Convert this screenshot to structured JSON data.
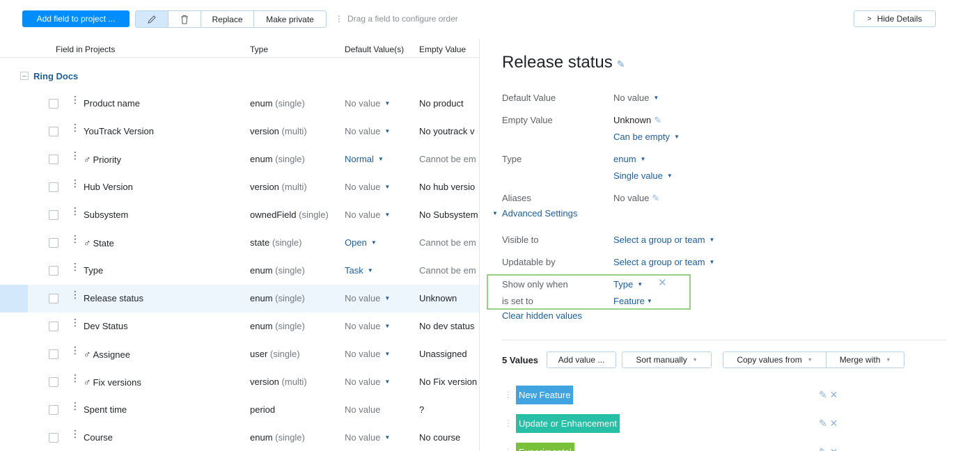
{
  "toolbar": {
    "add_label": "Add field to project ...",
    "replace_label": "Replace",
    "make_private_label": "Make private",
    "hint": "Drag a field to configure order",
    "hide_details_label": "Hide Details"
  },
  "table": {
    "headers": {
      "field": "Field in Projects",
      "type": "Type",
      "default": "Default Value(s)",
      "empty": "Empty Value"
    },
    "group": "Ring Docs",
    "rows": [
      {
        "name": "Product name",
        "icon": "",
        "type": "enum",
        "sub": "(single)",
        "def": "No value",
        "def_link": false,
        "def_caret": true,
        "empty": "No product",
        "empty_muted": false
      },
      {
        "name": "YouTrack Version",
        "icon": "",
        "type": "version",
        "sub": "(multi)",
        "def": "No value",
        "def_link": false,
        "def_caret": true,
        "empty": "No youtrack v",
        "empty_muted": false
      },
      {
        "name": "Priority",
        "icon": "♂",
        "type": "enum",
        "sub": "(single)",
        "def": "Normal",
        "def_link": true,
        "def_caret": true,
        "empty": "Cannot be em",
        "empty_muted": true
      },
      {
        "name": "Hub Version",
        "icon": "",
        "type": "version",
        "sub": "(multi)",
        "def": "No value",
        "def_link": false,
        "def_caret": true,
        "empty": "No hub versio",
        "empty_muted": false
      },
      {
        "name": "Subsystem",
        "icon": "",
        "type": "ownedField",
        "sub": "(single)",
        "def": "No value",
        "def_link": false,
        "def_caret": true,
        "empty": "No Subsystem",
        "empty_muted": false
      },
      {
        "name": "State",
        "icon": "♂",
        "type": "state",
        "sub": "(single)",
        "def": "Open",
        "def_link": true,
        "def_caret": true,
        "empty": "Cannot be em",
        "empty_muted": true
      },
      {
        "name": "Type",
        "icon": "",
        "type": "enum",
        "sub": "(single)",
        "def": "Task",
        "def_link": true,
        "def_caret": true,
        "empty": "Cannot be em",
        "empty_muted": true
      },
      {
        "name": "Release status",
        "icon": "",
        "type": "enum",
        "sub": "(single)",
        "def": "No value",
        "def_link": false,
        "def_caret": true,
        "empty": "Unknown",
        "empty_muted": false,
        "selected": true
      },
      {
        "name": "Dev Status",
        "icon": "",
        "type": "enum",
        "sub": "(single)",
        "def": "No value",
        "def_link": false,
        "def_caret": true,
        "empty": "No dev status",
        "empty_muted": false
      },
      {
        "name": "Assignee",
        "icon": "♂",
        "type": "user",
        "sub": "(single)",
        "def": "No value",
        "def_link": false,
        "def_caret": true,
        "empty": "Unassigned",
        "empty_muted": false
      },
      {
        "name": "Fix versions",
        "icon": "♂",
        "type": "version",
        "sub": "(multi)",
        "def": "No value",
        "def_link": false,
        "def_caret": true,
        "empty": "No Fix version",
        "empty_muted": false
      },
      {
        "name": "Spent time",
        "icon": "",
        "type": "period",
        "sub": "",
        "def": "No value",
        "def_link": false,
        "def_caret": false,
        "empty": "?",
        "empty_muted": false
      },
      {
        "name": "Course",
        "icon": "",
        "type": "enum",
        "sub": "(single)",
        "def": "No value",
        "def_link": false,
        "def_caret": true,
        "empty": "No course",
        "empty_muted": false
      }
    ]
  },
  "details": {
    "title": "Release status",
    "default_value_label": "Default Value",
    "default_value": "No value",
    "empty_value_label": "Empty Value",
    "empty_value": "Unknown",
    "can_be_empty": "Can be empty",
    "type_label": "Type",
    "type_value": "enum",
    "single_value": "Single value",
    "aliases_label": "Aliases",
    "aliases_value": "No value",
    "advanced_settings": "Advanced Settings",
    "visible_to_label": "Visible to",
    "visible_to_value": "Select a group or team",
    "updatable_by_label": "Updatable by",
    "updatable_by_value": "Select a group or team",
    "show_only_when_label": "Show only when",
    "show_only_when_value": "Type",
    "is_set_to_label": "is set to",
    "is_set_to_value": "Feature",
    "clear_hidden": "Clear hidden values",
    "values_count": "5 Values",
    "add_value": "Add value ...",
    "sort_manually": "Sort manually",
    "copy_values_from": "Copy values from",
    "merge_with": "Merge with",
    "values": [
      {
        "label": "New Feature",
        "color": "#3fa4e0"
      },
      {
        "label": "Update or Enhancement",
        "color": "#27bfa6"
      },
      {
        "label": "Experimental",
        "color": "#79c13a"
      }
    ]
  }
}
